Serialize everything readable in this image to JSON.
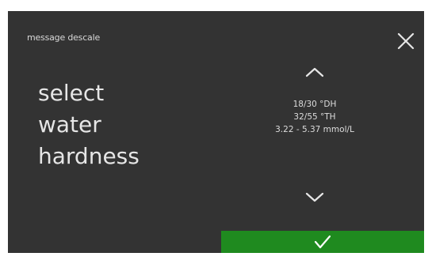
{
  "header": {
    "title": "message descale",
    "close_icon": "close-icon"
  },
  "main": {
    "label_lines": [
      "select",
      "water",
      "hardness"
    ]
  },
  "selector": {
    "up_icon": "chevron-up-icon",
    "down_icon": "chevron-down-icon",
    "values": [
      "18/30 °DH",
      "32/55 °TH",
      "3.22 - 5.37 mmol/L"
    ]
  },
  "confirm": {
    "icon": "checkmark-icon",
    "color": "#1f8a1f"
  },
  "colors": {
    "background": "#333333",
    "text": "#e6e6e6"
  }
}
